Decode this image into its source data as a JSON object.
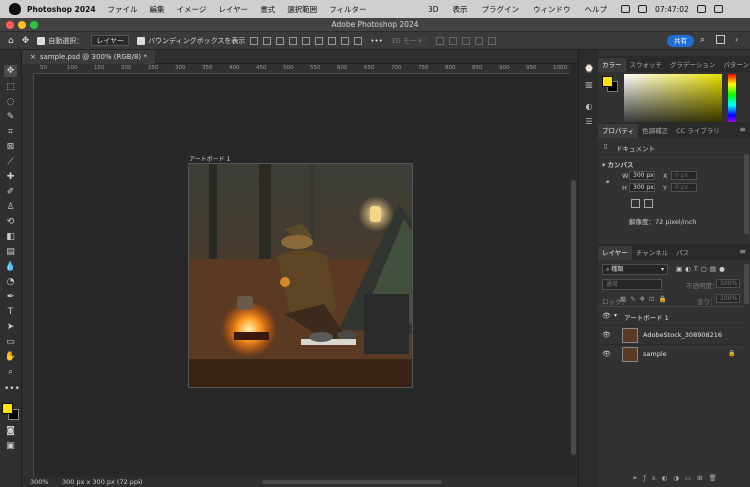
{
  "menubar": {
    "app_name": "Photoshop 2024",
    "items": [
      "ファイル",
      "編集",
      "イメージ",
      "レイヤー",
      "書式",
      "選択範囲",
      "フィルター"
    ],
    "right_items": [
      "3D",
      "表示",
      "プラグイン",
      "ウィンドウ",
      "ヘルプ"
    ],
    "clock": "07:47:02"
  },
  "window": {
    "title": "Adobe Photoshop 2024"
  },
  "options_bar": {
    "auto_select_label": "自動選択：",
    "auto_select_target": "レイヤー",
    "bounding_box_label": "バウンディングボックスを表示",
    "mode_3d_label": "3D モード：",
    "share_label": "共有"
  },
  "document": {
    "tab_title": "sample.psd @ 300% (RGB/8) *",
    "artboard_label": "アートボード 1",
    "ruler_ticks": [
      "50",
      "100",
      "150",
      "200",
      "250",
      "300",
      "350",
      "400",
      "450",
      "500",
      "550",
      "600",
      "650",
      "700",
      "750",
      "800",
      "850",
      "900",
      "950",
      "1000"
    ],
    "zoom": "300%",
    "doc_size": "300 px x 300 px (72 ppi)"
  },
  "color_panel": {
    "tabs": [
      "カラー",
      "スウォッチ",
      "グラデーション",
      "パターン"
    ],
    "colors": {
      "foreground": "#ffe400",
      "background": "#000000"
    }
  },
  "properties_panel": {
    "tabs": [
      "プロパティ",
      "色調補正",
      "CC ライブラリ"
    ],
    "doc_label": "ドキュメント",
    "canvas_label": "カンバス",
    "w_label": "W",
    "w_value": "300 px",
    "h_label": "H",
    "h_value": "300 px",
    "x_label": "X",
    "x_value": "0 px",
    "y_label": "Y",
    "y_value": "0 px",
    "resolution": "解像度：72 pixel/inch"
  },
  "layers_panel": {
    "tabs": [
      "レイヤー",
      "チャンネル",
      "パス"
    ],
    "filter_kind": "種類",
    "blend_mode": "通常",
    "opacity_label": "不透明度：",
    "opacity_value": "100%",
    "lock_label": "ロック：",
    "fill_label": "塗り：",
    "fill_value": "100%",
    "layers": [
      {
        "name": "アートボード 1"
      },
      {
        "name": "AdobeStock_308908216"
      },
      {
        "name": "sample"
      }
    ]
  }
}
